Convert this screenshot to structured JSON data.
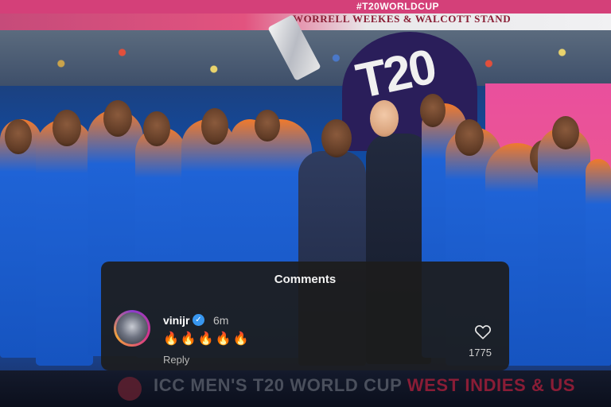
{
  "photo": {
    "hashtag": "#T20WORLDCUP",
    "stand_name": "WORRELL WEEKES & WALCOTT STAND",
    "backdrop_logo": "T20",
    "bottom_banner": {
      "main": "ICC MEN'S T20 WORLD CUP",
      "accent": "WEST INDIES & US"
    }
  },
  "comments": {
    "title": "Comments",
    "items": [
      {
        "username": "vinijr",
        "verified": true,
        "time": "6m",
        "text": "🔥🔥🔥🔥🔥",
        "reply_label": "Reply",
        "like_count": "1775",
        "like_icon": "heart-outline-icon"
      }
    ]
  },
  "colors": {
    "overlay_bg": "#1c1c1c",
    "verified_blue": "#3897f0",
    "jersey_blue": "#1654c0",
    "jersey_orange": "#f07a2c"
  }
}
